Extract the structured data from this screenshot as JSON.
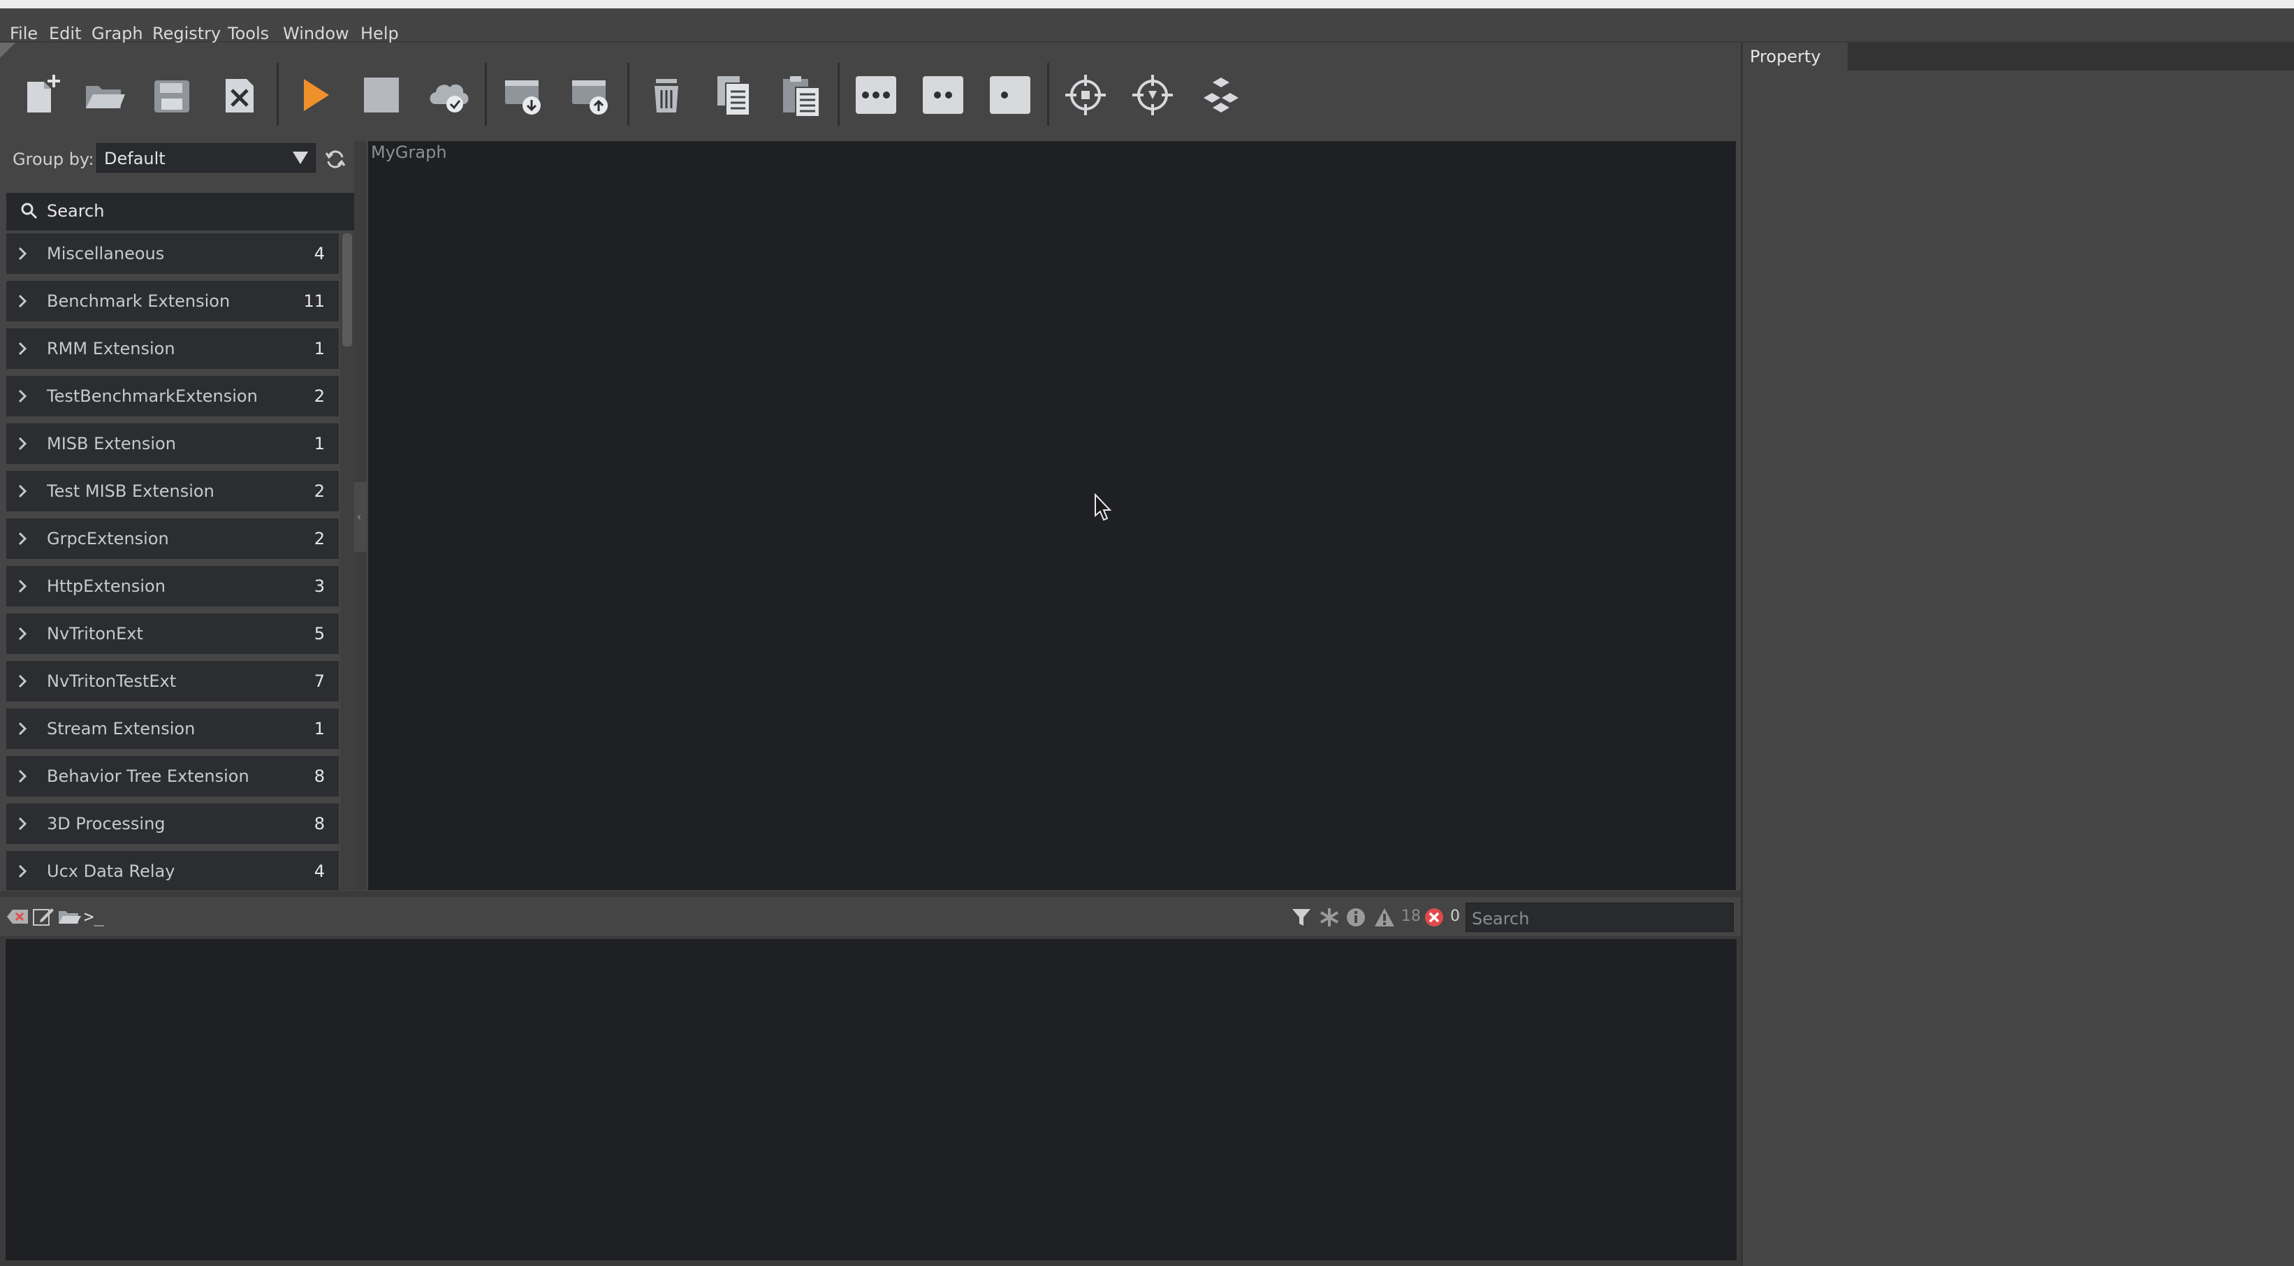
{
  "menu": {
    "items": [
      "File",
      "Edit",
      "Graph",
      "Registry",
      "Tools",
      "Window",
      "Help"
    ]
  },
  "toolbar": {
    "buttons": [
      {
        "name": "new-graph",
        "icon": "new-file-icon"
      },
      {
        "name": "open-graph",
        "icon": "folder-open-icon"
      },
      {
        "name": "save-graph",
        "icon": "save-icon"
      },
      {
        "name": "close-graph",
        "icon": "close-file-icon"
      },
      {
        "name": "run-graph",
        "icon": "play-icon"
      },
      {
        "name": "stop-graph",
        "icon": "stop-icon"
      },
      {
        "name": "deploy-graph",
        "icon": "cloud-check-icon"
      },
      {
        "name": "download-graph",
        "icon": "download-icon"
      },
      {
        "name": "upload-graph",
        "icon": "upload-icon"
      },
      {
        "name": "delete",
        "icon": "trash-icon"
      },
      {
        "name": "copy",
        "icon": "copy-icon"
      },
      {
        "name": "paste",
        "icon": "paste-icon"
      },
      {
        "name": "detail-full",
        "icon": "three-dots-icon"
      },
      {
        "name": "detail-medium",
        "icon": "two-dots-icon"
      },
      {
        "name": "detail-minimal",
        "icon": "one-dot-icon"
      },
      {
        "name": "center-view",
        "icon": "target-icon"
      },
      {
        "name": "center-selection",
        "icon": "target-alt-icon"
      },
      {
        "name": "auto-layout",
        "icon": "layout-icon"
      }
    ],
    "accent_color": "#f0902a"
  },
  "sidebar": {
    "group_by_label": "Group by:",
    "group_by_value": "Default",
    "search_label": "Search",
    "categories": [
      {
        "label": "Miscellaneous",
        "count": "4"
      },
      {
        "label": "Benchmark Extension",
        "count": "11"
      },
      {
        "label": "RMM Extension",
        "count": "1"
      },
      {
        "label": "TestBenchmarkExtension",
        "count": "2"
      },
      {
        "label": "MISB Extension",
        "count": "1"
      },
      {
        "label": "Test MISB Extension",
        "count": "2"
      },
      {
        "label": "GrpcExtension",
        "count": "2"
      },
      {
        "label": "HttpExtension",
        "count": "3"
      },
      {
        "label": "NvTritonExt",
        "count": "5"
      },
      {
        "label": "NvTritonTestExt",
        "count": "7"
      },
      {
        "label": "Stream Extension",
        "count": "1"
      },
      {
        "label": "Behavior Tree Extension",
        "count": "8"
      },
      {
        "label": "3D Processing",
        "count": "8"
      },
      {
        "label": "Ucx Data Relay",
        "count": "4"
      }
    ]
  },
  "graph": {
    "name": "MyGraph"
  },
  "console": {
    "prompt": ">_",
    "warning_count": "18",
    "error_count": "0",
    "search_placeholder": "Search",
    "error_color": "#e04a4a"
  },
  "property_panel": {
    "tab_label": "Property"
  }
}
